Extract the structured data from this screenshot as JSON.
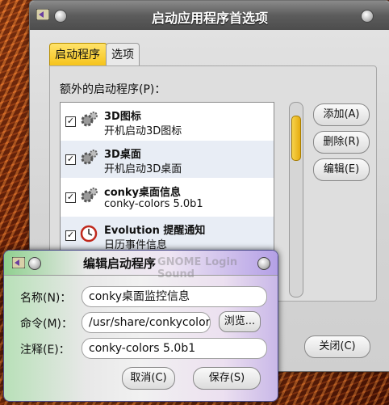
{
  "main_window": {
    "title": "启动应用程序首选项",
    "tabs": [
      {
        "label": "启动程序"
      },
      {
        "label": "选项"
      }
    ],
    "list_label": "额外的启动程序(P)：",
    "items": [
      {
        "name": "3D图标",
        "desc": "开机启动3D图标",
        "checked": true,
        "icon": "gear-icon"
      },
      {
        "name": "3D桌面",
        "desc": "开机启动3D桌面",
        "checked": true,
        "icon": "gear-icon"
      },
      {
        "name": "conky桌面信息",
        "desc": "conky-colors 5.0b1",
        "checked": true,
        "icon": "gear-icon"
      },
      {
        "name": "Evolution 提醒通知",
        "desc": "日历事件信息",
        "checked": true,
        "icon": "clock-icon"
      },
      {
        "name": "GNOME Login Sound",
        "desc": "",
        "checked": true,
        "icon": "gear-icon"
      }
    ],
    "buttons": {
      "add": "添加(A)",
      "delete": "删除(R)",
      "edit": "编辑(E)",
      "close": "关闭(C)"
    }
  },
  "edit_dialog": {
    "title": "编辑启动程序",
    "name_label": "名称(N)：",
    "name_value": "conky桌面监控信息",
    "command_label": "命令(M)：",
    "command_value": "/usr/share/conkycolors/",
    "browse_label": "浏览...",
    "comment_label": "注释(E)：",
    "comment_value": "conky-colors 5.0b1",
    "cancel_label": "取消(C)",
    "save_label": "保存(S)"
  }
}
